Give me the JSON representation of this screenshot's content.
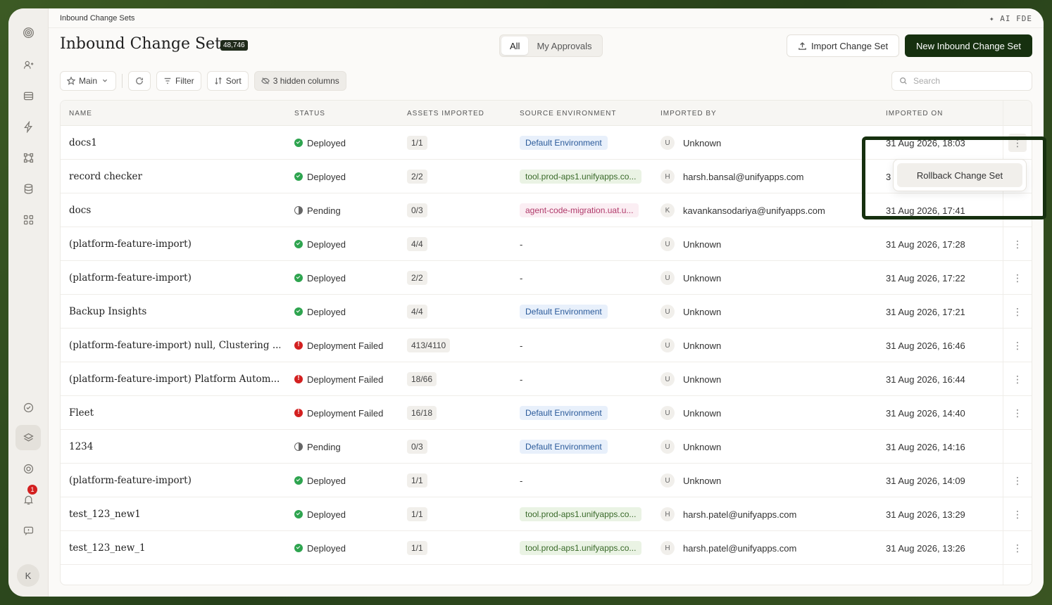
{
  "breadcrumb": "Inbound Change Sets",
  "ai_label": "✦ AI FDE",
  "page_title": "Inbound Change Sets",
  "count": "48,746",
  "tabs": [
    "All",
    "My Approvals"
  ],
  "buttons": {
    "import": "Import Change Set",
    "new": "New Inbound Change Set"
  },
  "toolbar": {
    "view": "Main",
    "filter": "Filter",
    "sort": "Sort",
    "hidden": "3 hidden columns"
  },
  "search_placeholder": "Search",
  "columns": [
    "NAME",
    "STATUS",
    "ASSETS IMPORTED",
    "SOURCE ENVIRONMENT",
    "IMPORTED BY",
    "IMPORTED ON"
  ],
  "popup_item": "Rollback Change Set",
  "notification_count": "1",
  "user_initial": "K",
  "rows": [
    {
      "name": "docs1",
      "status": "Deployed",
      "status_kind": "deployed",
      "assets": "1/1",
      "env": "Default Environment",
      "env_kind": "blue",
      "by_initial": "U",
      "by": "Unknown",
      "on": "31 Aug 2026, 18:03",
      "menu": "⋮"
    },
    {
      "name": "record checker",
      "status": "Deployed",
      "status_kind": "deployed",
      "assets": "2/2",
      "env": "tool.prod-aps1.unifyapps.co...",
      "env_kind": "green",
      "by_initial": "H",
      "by": "harsh.bansal@unifyapps.com",
      "on": "3",
      "menu": ""
    },
    {
      "name": "docs",
      "status": "Pending",
      "status_kind": "pending",
      "assets": "0/3",
      "env": "agent-code-migration.uat.u...",
      "env_kind": "pink",
      "by_initial": "K",
      "by": "kavankansodariya@unifyapps.com",
      "on": "31 Aug 2026, 17:41",
      "menu": ""
    },
    {
      "name": "(platform-feature-import)",
      "status": "Deployed",
      "status_kind": "deployed",
      "assets": "4/4",
      "env": "-",
      "env_kind": "none",
      "by_initial": "U",
      "by": "Unknown",
      "on": "31 Aug 2026, 17:28",
      "menu": "⋮"
    },
    {
      "name": "(platform-feature-import)",
      "status": "Deployed",
      "status_kind": "deployed",
      "assets": "2/2",
      "env": "-",
      "env_kind": "none",
      "by_initial": "U",
      "by": "Unknown",
      "on": "31 Aug 2026, 17:22",
      "menu": "⋮"
    },
    {
      "name": "Backup Insights",
      "status": "Deployed",
      "status_kind": "deployed",
      "assets": "4/4",
      "env": "Default Environment",
      "env_kind": "blue",
      "by_initial": "U",
      "by": "Unknown",
      "on": "31 Aug 2026, 17:21",
      "menu": "⋮"
    },
    {
      "name": "(platform-feature-import) null, Clustering ...",
      "status": "Deployment Failed",
      "status_kind": "failed",
      "assets": "413/4110",
      "env": "-",
      "env_kind": "none",
      "by_initial": "U",
      "by": "Unknown",
      "on": "31 Aug 2026, 16:46",
      "menu": "⋮"
    },
    {
      "name": "(platform-feature-import) Platform Autom...",
      "status": "Deployment Failed",
      "status_kind": "failed",
      "assets": "18/66",
      "env": "-",
      "env_kind": "none",
      "by_initial": "U",
      "by": "Unknown",
      "on": "31 Aug 2026, 16:44",
      "menu": "⋮"
    },
    {
      "name": "Fleet",
      "status": "Deployment Failed",
      "status_kind": "failed",
      "assets": "16/18",
      "env": "Default Environment",
      "env_kind": "blue",
      "by_initial": "U",
      "by": "Unknown",
      "on": "31 Aug 2026, 14:40",
      "menu": "⋮"
    },
    {
      "name": "1234",
      "status": "Pending",
      "status_kind": "pending",
      "assets": "0/3",
      "env": "Default Environment",
      "env_kind": "blue",
      "by_initial": "U",
      "by": "Unknown",
      "on": "31 Aug 2026, 14:16",
      "menu": ""
    },
    {
      "name": "(platform-feature-import)",
      "status": "Deployed",
      "status_kind": "deployed",
      "assets": "1/1",
      "env": "-",
      "env_kind": "none",
      "by_initial": "U",
      "by": "Unknown",
      "on": "31 Aug 2026, 14:09",
      "menu": "⋮"
    },
    {
      "name": "test_123_new1",
      "status": "Deployed",
      "status_kind": "deployed",
      "assets": "1/1",
      "env": "tool.prod-aps1.unifyapps.co...",
      "env_kind": "green",
      "by_initial": "H",
      "by": "harsh.patel@unifyapps.com",
      "on": "31 Aug 2026, 13:29",
      "menu": "⋮"
    },
    {
      "name": "test_123_new_1",
      "status": "Deployed",
      "status_kind": "deployed",
      "assets": "1/1",
      "env": "tool.prod-aps1.unifyapps.co...",
      "env_kind": "green",
      "by_initial": "H",
      "by": "harsh.patel@unifyapps.com",
      "on": "31 Aug 2026, 13:26",
      "menu": "⋮"
    }
  ]
}
